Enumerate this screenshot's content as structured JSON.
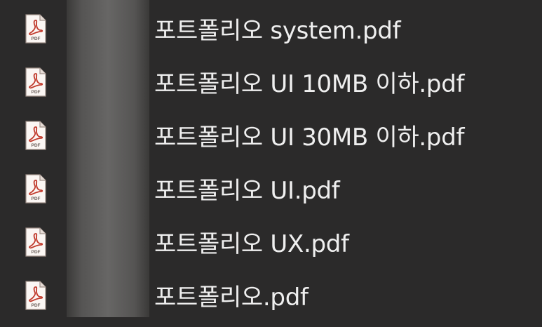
{
  "files": [
    {
      "name": "포트폴리오 system.pdf",
      "icon": "pdf-file-icon",
      "icon_label": "PDF"
    },
    {
      "name": "포트폴리오 UI 10MB 이하.pdf",
      "icon": "pdf-file-icon",
      "icon_label": "PDF"
    },
    {
      "name": "포트폴리오 UI 30MB 이하.pdf",
      "icon": "pdf-file-icon",
      "icon_label": "PDF"
    },
    {
      "name": "포트폴리오 UI.pdf",
      "icon": "pdf-file-icon",
      "icon_label": "PDF"
    },
    {
      "name": "포트폴리오 UX.pdf",
      "icon": "pdf-file-icon",
      "icon_label": "PDF"
    },
    {
      "name": "포트폴리오.pdf",
      "icon": "pdf-file-icon",
      "icon_label": "PDF"
    }
  ],
  "colors": {
    "background": "#2b2a2a",
    "text": "#efefef",
    "pdf_accent": "#c0392b"
  }
}
